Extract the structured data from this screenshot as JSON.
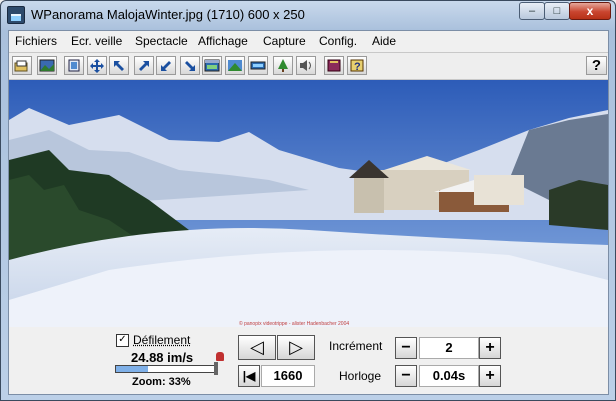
{
  "window": {
    "title": "WPanorama  MalojaWinter.jpg   (1710) 600 x 250",
    "min_label": "–",
    "max_label": "□",
    "close_label": "x"
  },
  "menu": [
    "Fichiers",
    "Ecr. veille",
    "Spectacle",
    "Affichage",
    "Capture",
    "Config.",
    "Aide"
  ],
  "toolbar": {
    "icons": [
      "open-icon",
      "picture-icon",
      "crop-icon",
      "move-icon",
      "arrow-up-left-icon",
      "arrow-up-right-icon",
      "arrow-down-left-icon",
      "arrow-down-right-icon",
      "window-icon",
      "landscape-icon",
      "window-small-icon",
      "tree-icon",
      "sound-icon",
      "book-icon",
      "help-book-icon"
    ],
    "help_label": "?"
  },
  "image": {
    "caption": "© panopix videotrippe - alister Hadenbacher 2004"
  },
  "controls": {
    "scroll_checkbox_mark": "✓",
    "scroll_label": "Défilement",
    "speed": "24.88 im/s",
    "zoom_fraction": 0.33,
    "zoom_label": "Zoom: 33%",
    "prev_label": "◁",
    "next_label": "▷",
    "first_label": "|◀",
    "position": "1660",
    "increment_label": "Incrément",
    "increment_value": "2",
    "clock_label": "Horloge",
    "clock_value": "0.04s",
    "minus_label": "−",
    "plus_label": "+"
  },
  "colors": {
    "sky": "#4a78c6",
    "snow": "#eef2fa",
    "accent": "#7fb0e8"
  }
}
